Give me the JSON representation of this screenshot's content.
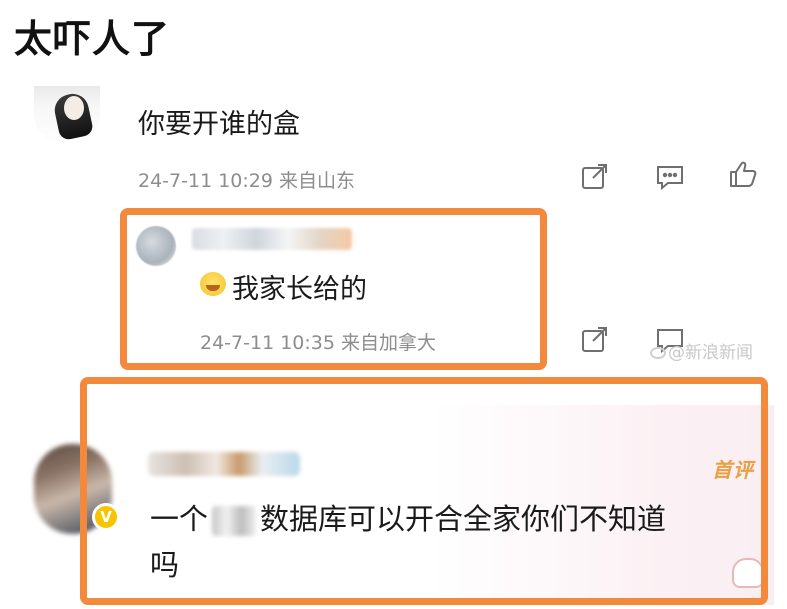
{
  "page": {
    "title": "太吓人了"
  },
  "comment_1": {
    "text": "你要开谁的盒",
    "meta": "24-7-11 10:29 来自山东",
    "actions": [
      "share-icon",
      "comment-icon",
      "like-icon"
    ]
  },
  "reply_1": {
    "text": "我家长给的",
    "emoji": "crying-face-emoji",
    "meta": "24-7-11 10:35 来自加拿大",
    "actions": [
      "share-icon",
      "comment-icon",
      "like-icon"
    ]
  },
  "watermark": {
    "text": "@新浪新闻"
  },
  "comment_2": {
    "text_before": "一个",
    "text_after": "数据库可以开合全家你们不知道",
    "text_line2": "吗",
    "badge": "首评"
  },
  "colors": {
    "highlight": "#f2893d",
    "meta_text": "#8d8d8d",
    "first_comment_badge": "#e7a043",
    "vip_badge": "#f6c400"
  }
}
